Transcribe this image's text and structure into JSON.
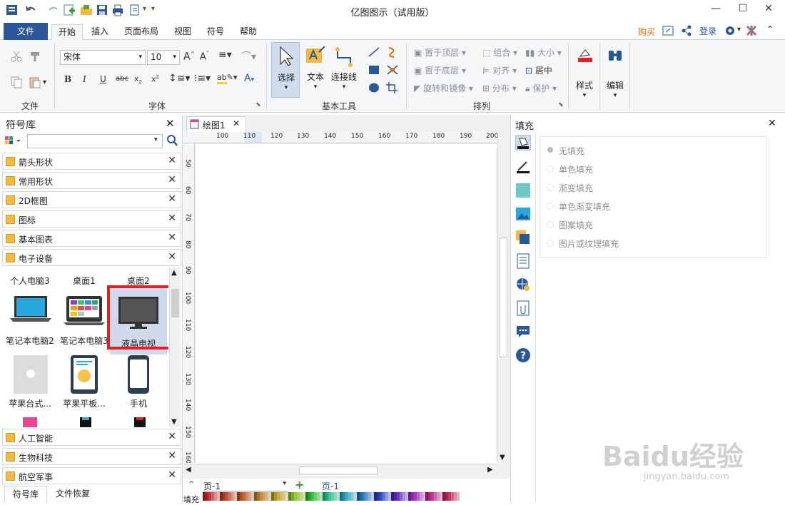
{
  "window": {
    "title": "亿图图示（试用版）",
    "min": "—",
    "max": "☐",
    "close": "✕"
  },
  "menu": {
    "file": "文件",
    "tabs": [
      "开始",
      "插入",
      "页面布局",
      "视图",
      "符号",
      "帮助"
    ],
    "buy": "购买",
    "login": "登录"
  },
  "ribbon": {
    "groups": {
      "file": "文件",
      "font": "字体",
      "basic": "基本工具",
      "arrange": "排列"
    },
    "font_name": "宋体",
    "font_size": "10",
    "select": "选择",
    "text": "文本",
    "connector": "连接线",
    "arrange_items": [
      "置于顶层",
      "置于底层",
      "旋转和镜像",
      "组合",
      "对齐",
      "分布",
      "大小",
      "居中",
      "保护"
    ],
    "style": "样式",
    "edit": "编辑"
  },
  "library": {
    "title": "符号库",
    "search_placeholder": "",
    "categories_top": [
      "箭头形状",
      "常用形状",
      "2D框图",
      "图标",
      "基本图表",
      "电子设备"
    ],
    "symbols_row0": [
      "个人电脑3",
      "桌面1",
      "桌面2"
    ],
    "symbols_row1": [
      "笔记本电脑2",
      "笔记本电脑3",
      "液晶电视"
    ],
    "symbols_row2": [
      "苹果台式...",
      "苹果平板...",
      "手机"
    ],
    "categories_bottom": [
      "人工智能",
      "生物科技",
      "航空军事"
    ],
    "bottom_tabs": [
      "符号库",
      "文件恢复"
    ]
  },
  "document": {
    "tab": "绘图1",
    "ruler_h": [
      "100",
      "110",
      "120",
      "130",
      "140",
      "150",
      "160",
      "170",
      "180",
      "190",
      "200"
    ],
    "ruler_v": [
      "50",
      "60",
      "70",
      "80",
      "90",
      "100",
      "110",
      "120",
      "130",
      "140",
      "150",
      "160"
    ]
  },
  "pages": {
    "select": "页-1",
    "current": "页-1",
    "add": "+"
  },
  "fill_label": "填充",
  "fill_panel": {
    "title": "填充",
    "options": [
      "无填充",
      "单色填充",
      "渐变填充",
      "单色渐变填充",
      "图案填充",
      "图片或纹理填充"
    ]
  },
  "watermark": {
    "brand": "Baidu经验",
    "url": "jingyan.baidu.com"
  },
  "colors": {
    "accent": "#2b5797",
    "highlight": "#e81c24",
    "buy": "#e06c00"
  }
}
